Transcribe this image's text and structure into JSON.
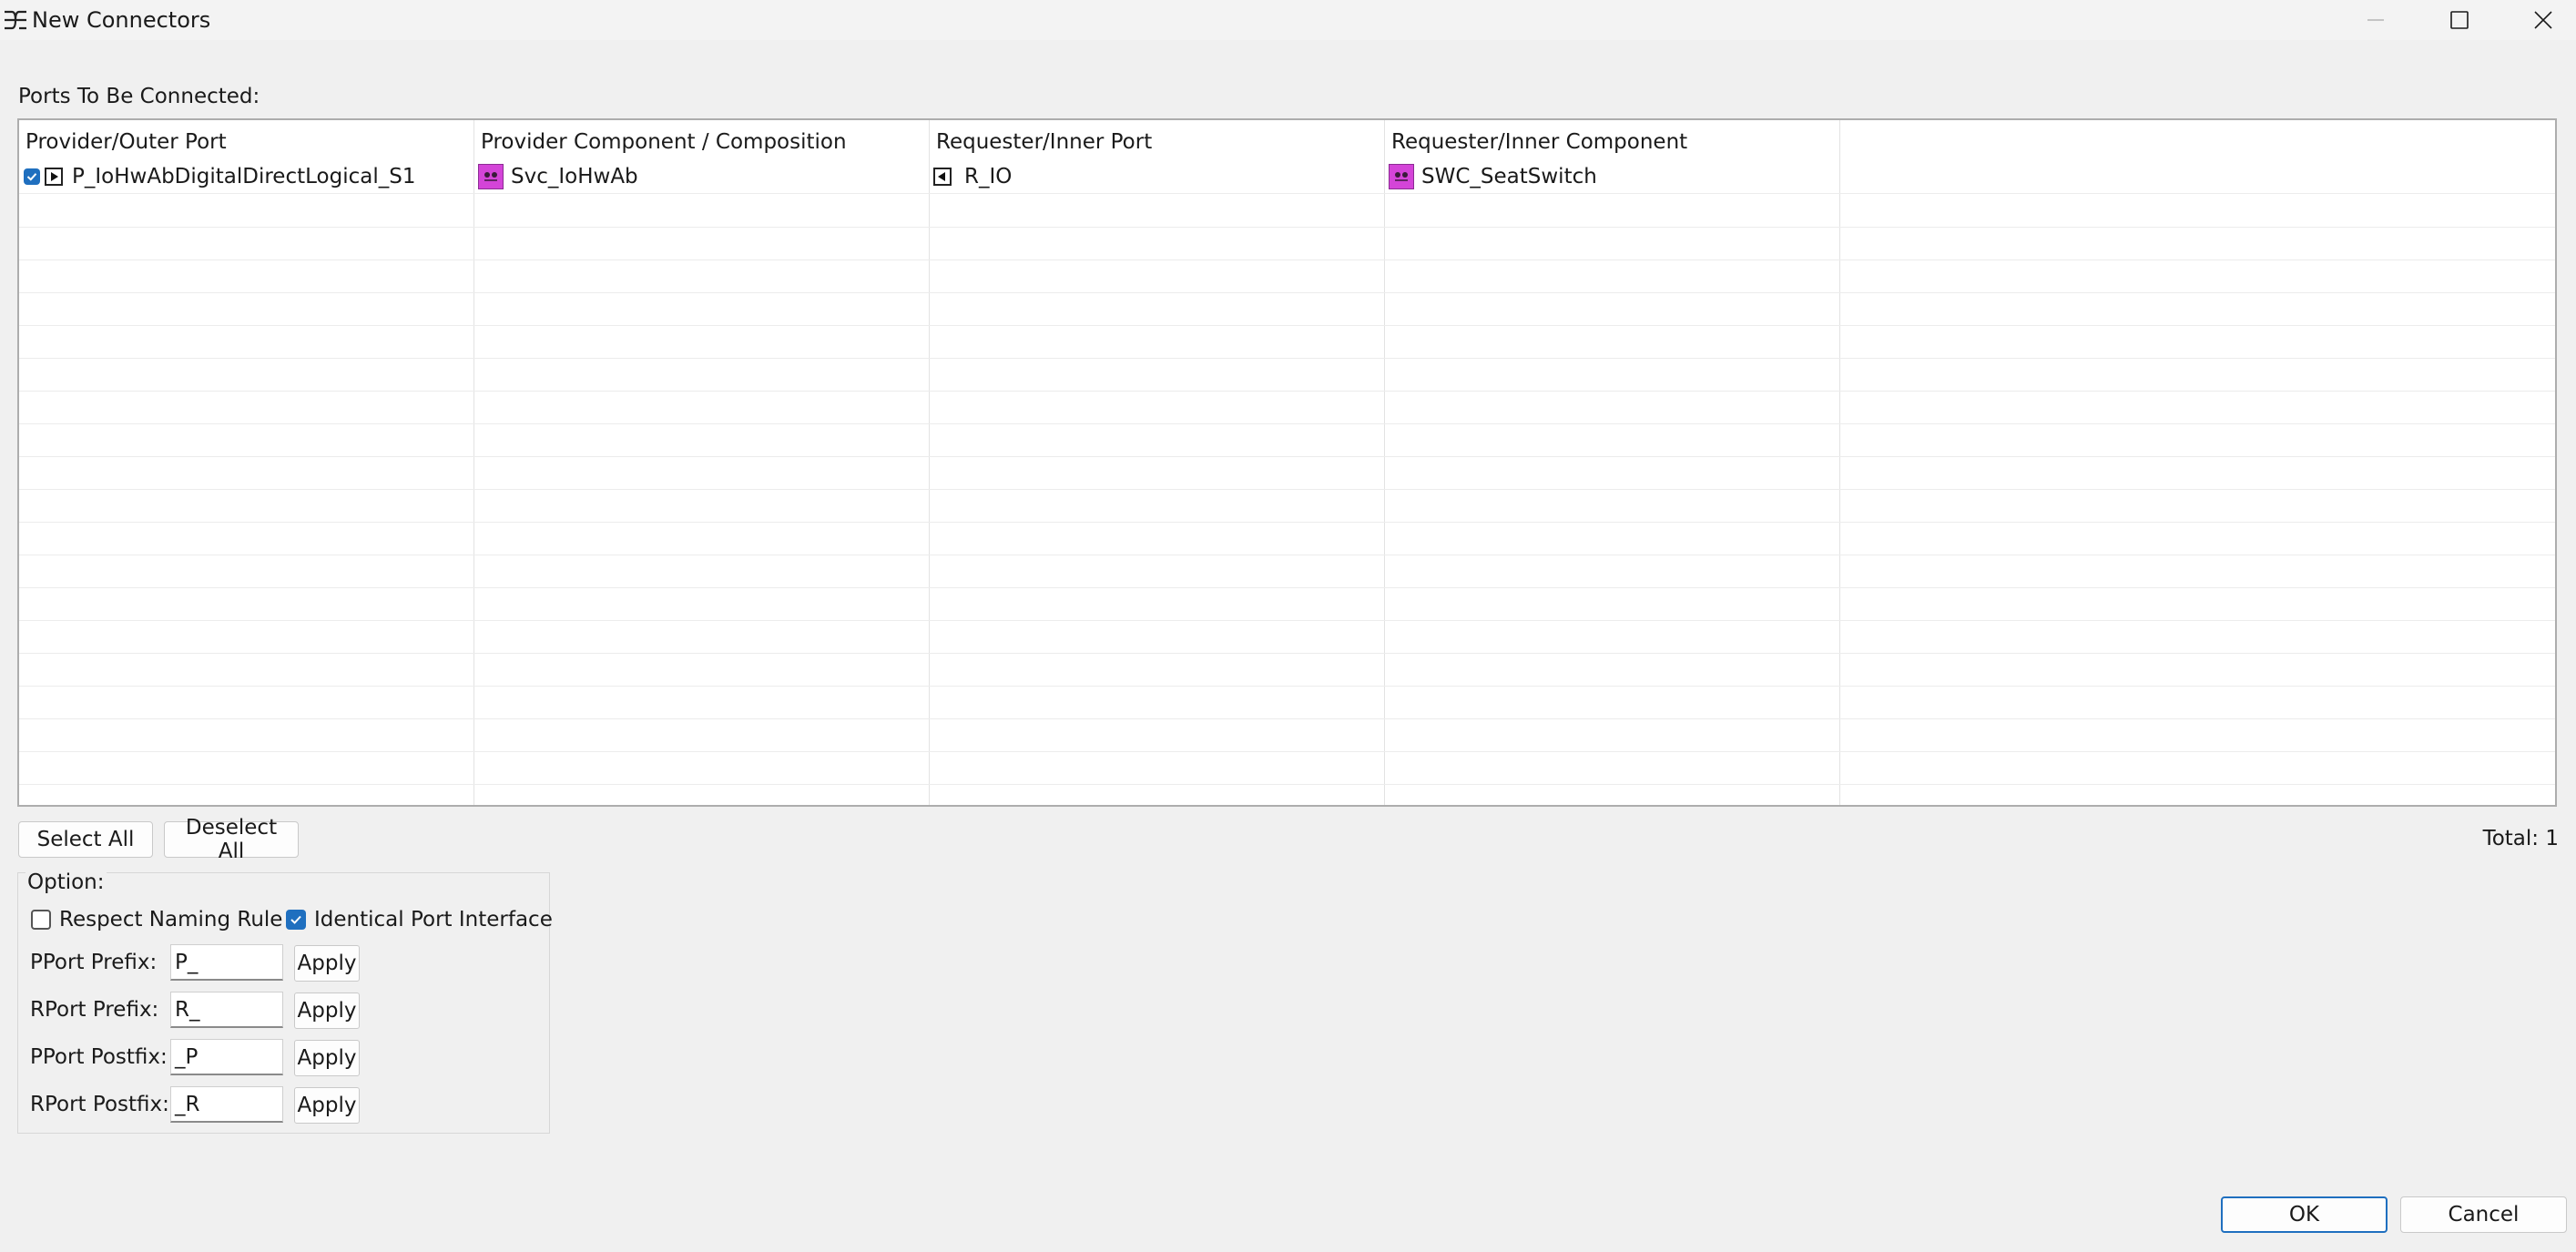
{
  "window": {
    "title": "New Connectors",
    "icon": "connector-icon"
  },
  "ports_label": "Ports To Be Connected:",
  "table": {
    "columns": [
      "Provider/Outer Port",
      "Provider Component / Composition",
      "Requester/Inner Port",
      "Requester/Inner Component"
    ],
    "rows": [
      {
        "checked": true,
        "provider_port": "P_IoHwAbDigitalDirectLogical_S1",
        "provider_component": "Svc_IoHwAb",
        "requester_port": "R_IO",
        "requester_component": "SWC_SeatSwitch"
      }
    ]
  },
  "buttons": {
    "select_all": "Select All",
    "deselect_all": "Deselect All",
    "ok": "OK",
    "cancel": "Cancel"
  },
  "total_label": "Total: 1",
  "options": {
    "legend": "Option:",
    "respect_naming_rule": {
      "label": "Respect Naming Rule",
      "checked": false
    },
    "identical_port_interface": {
      "label": "Identical Port Interface",
      "checked": true
    },
    "fields": [
      {
        "label": "PPort Prefix:",
        "value": "P_",
        "apply": "Apply"
      },
      {
        "label": "RPort Prefix:",
        "value": "R_",
        "apply": "Apply"
      },
      {
        "label": "PPort Postfix:",
        "value": "_P",
        "apply": "Apply"
      },
      {
        "label": "RPort Postfix:",
        "value": "_R",
        "apply": "Apply"
      }
    ]
  },
  "colors": {
    "accent": "#1f6fbf",
    "component_icon": "#d444d8"
  }
}
